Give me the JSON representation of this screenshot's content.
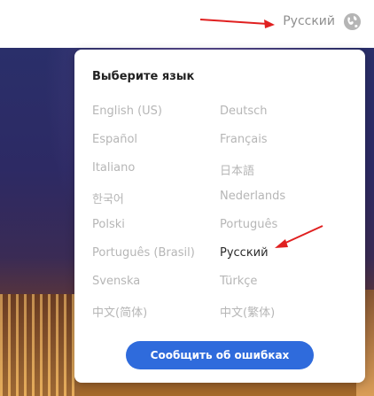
{
  "header": {
    "current_language": "Русский",
    "globe_icon": "globe-icon"
  },
  "language_modal": {
    "title": "Выберите язык",
    "languages_left": [
      "English (US)",
      "Español",
      "Italiano",
      "한국어",
      "Polski",
      "Português (Brasil)",
      "Svenska",
      "中文(简体)"
    ],
    "languages_right": [
      "Deutsch",
      "Français",
      "日本語",
      "Nederlands",
      "Português",
      "Русский",
      "Türkçe",
      "中文(繁体)"
    ],
    "selected": "Русский",
    "report_button": "Сообщить об ошибках"
  },
  "annotations": {
    "arrow_color": "#e02020"
  },
  "colors": {
    "accent": "#2f6bdc",
    "inactive_text": "#b6b6b6",
    "active_text": "#2b2b2b"
  }
}
